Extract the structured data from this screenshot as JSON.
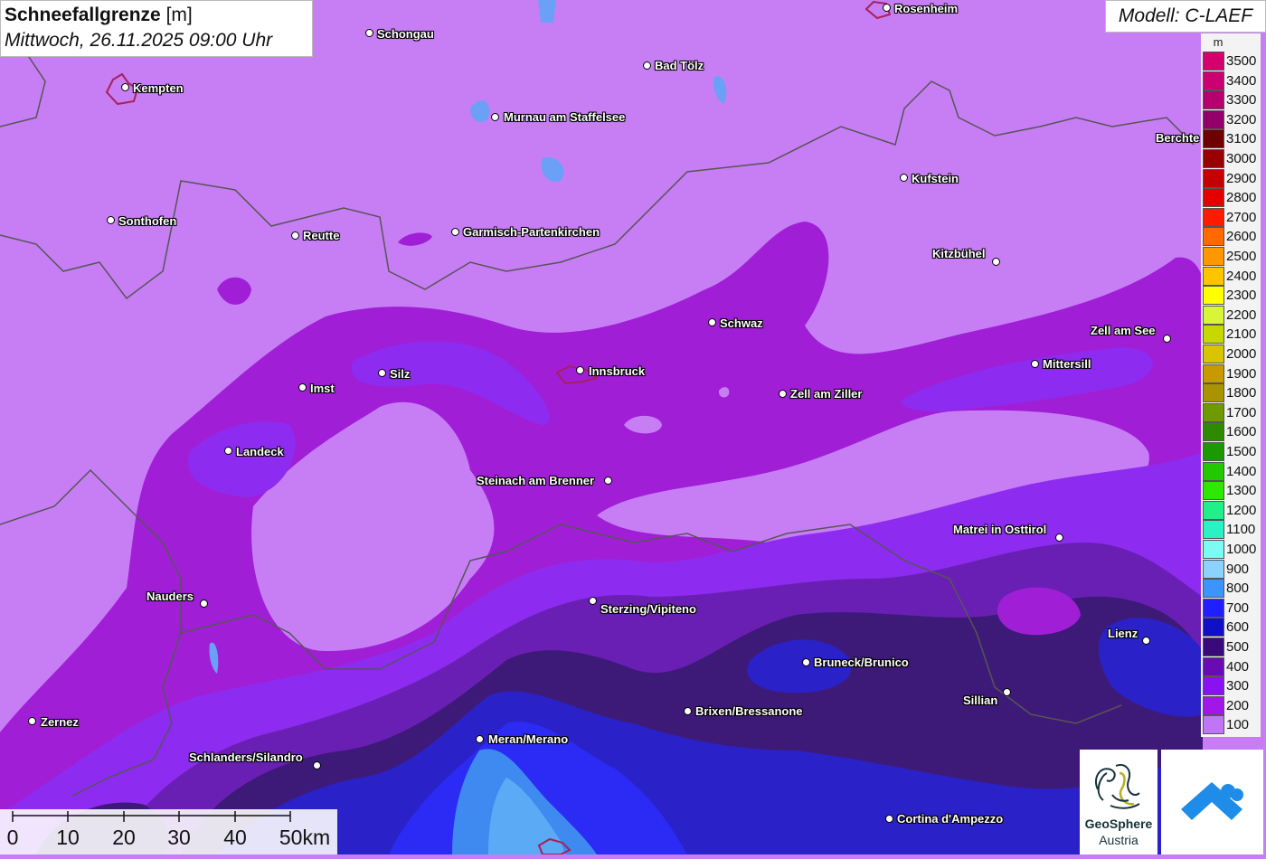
{
  "header": {
    "title": "Schneefallgrenze",
    "unit": "[m]",
    "datetime": "Mittwoch, 26.11.2025 09:00 Uhr"
  },
  "model_label": "Modell: C-LAEF",
  "legend": {
    "unit": "m",
    "entries": [
      {
        "label": "3500",
        "color": "#d4006e"
      },
      {
        "label": "3400",
        "color": "#cc0070"
      },
      {
        "label": "3300",
        "color": "#b5006f"
      },
      {
        "label": "3200",
        "color": "#94006a"
      },
      {
        "label": "3100",
        "color": "#6e0000"
      },
      {
        "label": "3000",
        "color": "#9a0000"
      },
      {
        "label": "2900",
        "color": "#c40000"
      },
      {
        "label": "2800",
        "color": "#e50000"
      },
      {
        "label": "2700",
        "color": "#ff1a00"
      },
      {
        "label": "2600",
        "color": "#ff6a00"
      },
      {
        "label": "2500",
        "color": "#ff9800"
      },
      {
        "label": "2400",
        "color": "#ffc400"
      },
      {
        "label": "2300",
        "color": "#ffff00"
      },
      {
        "label": "2200",
        "color": "#d9f53a"
      },
      {
        "label": "2100",
        "color": "#c6d800"
      },
      {
        "label": "2000",
        "color": "#d8c400"
      },
      {
        "label": "1900",
        "color": "#c79a00"
      },
      {
        "label": "1800",
        "color": "#a89400"
      },
      {
        "label": "1700",
        "color": "#6e9a00"
      },
      {
        "label": "1600",
        "color": "#2e8a00"
      },
      {
        "label": "1500",
        "color": "#1a9a00"
      },
      {
        "label": "1400",
        "color": "#22c800"
      },
      {
        "label": "1300",
        "color": "#2ee800"
      },
      {
        "label": "1200",
        "color": "#20f08a"
      },
      {
        "label": "1100",
        "color": "#2af2c4"
      },
      {
        "label": "1000",
        "color": "#7dfaf2"
      },
      {
        "label": "900",
        "color": "#8cd2ff"
      },
      {
        "label": "800",
        "color": "#3d94ff"
      },
      {
        "label": "700",
        "color": "#1f1fff"
      },
      {
        "label": "600",
        "color": "#1010c8"
      },
      {
        "label": "500",
        "color": "#3a0a7a"
      },
      {
        "label": "400",
        "color": "#6a0ab4"
      },
      {
        "label": "300",
        "color": "#8a12f0"
      },
      {
        "label": "200",
        "color": "#a216e8"
      },
      {
        "label": "100",
        "color": "#c274f6"
      }
    ]
  },
  "scale": {
    "ticks": [
      "0",
      "10",
      "20",
      "30",
      "40",
      "50km"
    ]
  },
  "cities": [
    {
      "name": "Rosenheim"
    },
    {
      "name": "Schongau"
    },
    {
      "name": "Kempten"
    },
    {
      "name": "Bad Tölz"
    },
    {
      "name": "Murnau am Staffelsee"
    },
    {
      "name": "Berchte"
    },
    {
      "name": "Kufstein"
    },
    {
      "name": "Sonthofen"
    },
    {
      "name": "Reutte"
    },
    {
      "name": "Garmisch-Partenkirchen"
    },
    {
      "name": "Kitzbühel"
    },
    {
      "name": "Schwaz"
    },
    {
      "name": "Zell am See"
    },
    {
      "name": "Mittersill"
    },
    {
      "name": "Innsbruck"
    },
    {
      "name": "Silz"
    },
    {
      "name": "Imst"
    },
    {
      "name": "Zell am Ziller"
    },
    {
      "name": "Landeck"
    },
    {
      "name": "Steinach am Brenner"
    },
    {
      "name": "Matrei in Osttirol"
    },
    {
      "name": "Nauders"
    },
    {
      "name": "Sterzing/Vipiteno"
    },
    {
      "name": "Lienz"
    },
    {
      "name": "Bruneck/Brunico"
    },
    {
      "name": "Sillian"
    },
    {
      "name": "Brixen/Bressanone"
    },
    {
      "name": "Zernez"
    },
    {
      "name": "Meran/Merano"
    },
    {
      "name": "Schlanders/Silandro"
    },
    {
      "name": "Cortina d'Ampezzo"
    }
  ],
  "logos": {
    "geosphere_name": "GeoSphere",
    "geosphere_sub": "Austria"
  },
  "colors": {
    "band_100": "#c77ef5",
    "band_200": "#a01fd6",
    "band_300": "#8d2cf0",
    "band_400": "#6a1fb4",
    "band_500": "#3e1a78",
    "band_600": "#2a22c8",
    "band_700": "#2b2bf5",
    "band_800": "#3f8af0",
    "band_900": "#5aaaf5"
  }
}
